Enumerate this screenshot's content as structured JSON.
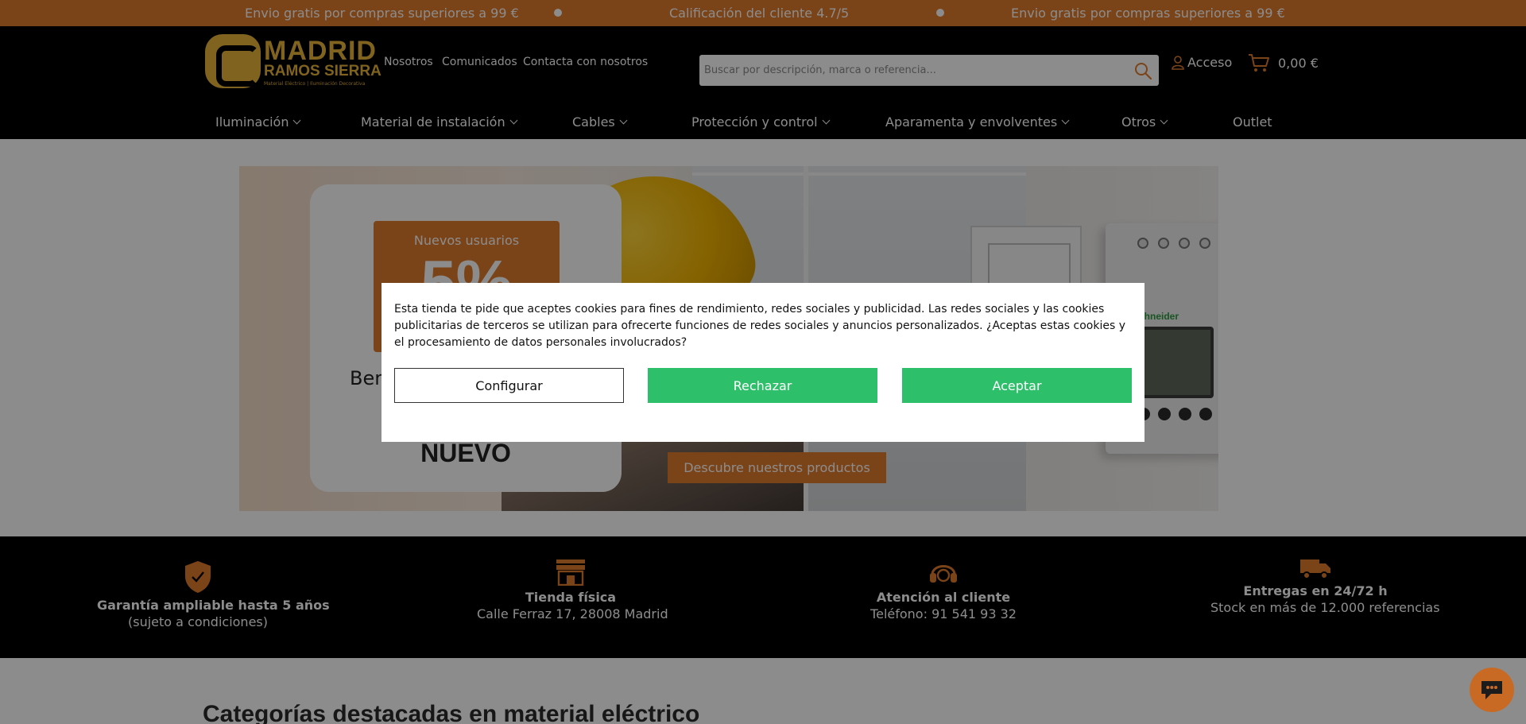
{
  "promo": {
    "left": "Envio gratis por compras superiores a 99 €",
    "center": "Calificación del cliente 4.7/5",
    "right": "Envio gratis por compras superiores a 99 €"
  },
  "brand": {
    "line1": "MADRID",
    "line2": "RAMOS SIERRA",
    "tagline": "Material Eléctrico | Iluminación Decorativa"
  },
  "top_links": [
    "Nosotros",
    "Comunicados",
    "Contacta con nosotros"
  ],
  "search": {
    "placeholder": "Buscar por descripción, marca o referencia...",
    "value": ""
  },
  "account": {
    "label": "Acceso"
  },
  "cart": {
    "total": "0,00 €"
  },
  "nav": [
    {
      "label": "Iluminación",
      "dropdown": true
    },
    {
      "label": "Material de instalación",
      "dropdown": true
    },
    {
      "label": "Cables",
      "dropdown": true
    },
    {
      "label": "Protección y control",
      "dropdown": true
    },
    {
      "label": "Aparamenta y envolventes",
      "dropdown": true
    },
    {
      "label": "Otros",
      "dropdown": true
    },
    {
      "label": "Outlet",
      "dropdown": false
    }
  ],
  "hero": {
    "badge_label": "Nuevos usuarios",
    "badge_value": "5%",
    "welcome_text": "Ben",
    "new_label": "NUEVO",
    "device_brand": "Schneider",
    "cta": "Descubre nuestros productos"
  },
  "features": [
    {
      "icon": "shield-check-icon",
      "title": "Garantía ampliable hasta 5 años",
      "subtitle": "(sujeto a condiciones)"
    },
    {
      "icon": "store-icon",
      "title": "Tienda física",
      "subtitle": "Calle Ferraz 17, 28008 Madrid"
    },
    {
      "icon": "headset-icon",
      "title": "Atención al cliente",
      "subtitle": "Teléfono: 91 541 93 32"
    },
    {
      "icon": "truck-icon",
      "title": "Entregas en 24/72 h",
      "subtitle": "Stock en más de 12.000 referencias"
    }
  ],
  "section_title": "Categorías destacadas en material eléctrico",
  "cookie": {
    "text": "Esta tienda te pide que aceptes cookies para fines de rendimiento, redes sociales y publicidad. Las redes sociales y las cookies publicitarias de terceros se utilizan para ofrecerte funciones de redes sociales y anuncios personalizados. ¿Aceptas estas cookies y el procesamiento de datos personales involucrados?",
    "configure": "Configurar",
    "reject": "Rechazar",
    "accept": "Aceptar"
  },
  "colors": {
    "accent_orange": "#e07b2c",
    "header_black": "#000000",
    "button_green": "#2ebf6a",
    "logo_gold": "#e8b43a"
  }
}
